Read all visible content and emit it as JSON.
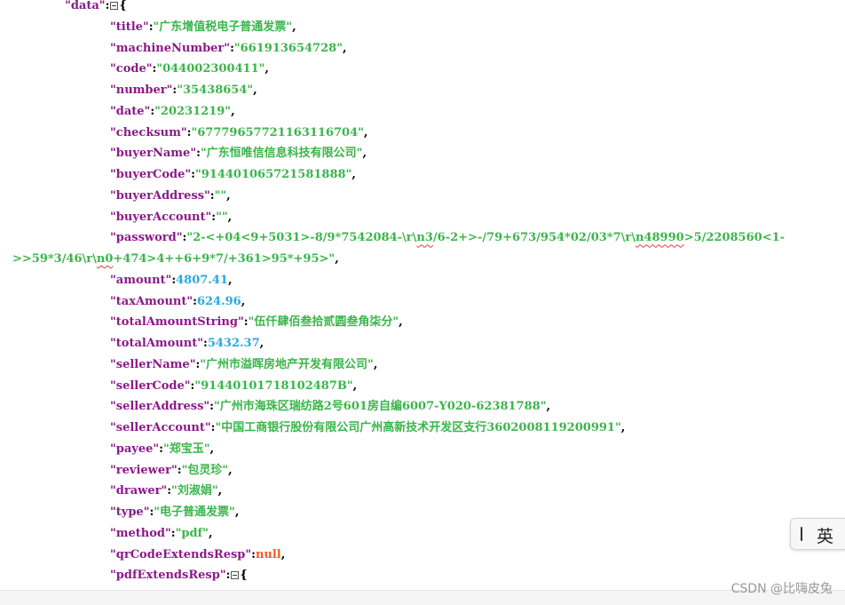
{
  "lines": [
    {
      "indent": "",
      "parts": [
        {
          "t": "  ",
          "c": "p"
        },
        {
          "t": "\"data\"",
          "c": "k"
        },
        {
          "t": ":",
          "c": "p"
        },
        {
          "fold": true
        },
        {
          "t": "{",
          "c": "p"
        }
      ]
    },
    {
      "parts": [
        {
          "t": "\"title\"",
          "c": "k"
        },
        {
          "t": ":",
          "c": "p"
        },
        {
          "t": "\"广东增值税电子普通发票\"",
          "c": "s"
        },
        {
          "t": ",",
          "c": "p"
        }
      ]
    },
    {
      "parts": [
        {
          "t": "\"machineNumber\"",
          "c": "k"
        },
        {
          "t": ":",
          "c": "p"
        },
        {
          "t": "\"661913654728\"",
          "c": "s"
        },
        {
          "t": ",",
          "c": "p"
        }
      ]
    },
    {
      "parts": [
        {
          "t": "\"code\"",
          "c": "k"
        },
        {
          "t": ":",
          "c": "p"
        },
        {
          "t": "\"044002300411\"",
          "c": "s"
        },
        {
          "t": ",",
          "c": "p"
        }
      ]
    },
    {
      "parts": [
        {
          "t": "\"number\"",
          "c": "k"
        },
        {
          "t": ":",
          "c": "p"
        },
        {
          "t": "\"35438654\"",
          "c": "s"
        },
        {
          "t": ",",
          "c": "p"
        }
      ]
    },
    {
      "parts": [
        {
          "t": "\"date\"",
          "c": "k"
        },
        {
          "t": ":",
          "c": "p"
        },
        {
          "t": "\"20231219\"",
          "c": "s"
        },
        {
          "t": ",",
          "c": "p"
        }
      ]
    },
    {
      "parts": [
        {
          "t": "\"checksum\"",
          "c": "k"
        },
        {
          "t": ":",
          "c": "p"
        },
        {
          "t": "\"67779657721163116704\"",
          "c": "s"
        },
        {
          "t": ",",
          "c": "p"
        }
      ]
    },
    {
      "parts": [
        {
          "t": "\"buyerName\"",
          "c": "k"
        },
        {
          "t": ":",
          "c": "p"
        },
        {
          "t": "\"广东恒唯信信息科技有限公司\"",
          "c": "s"
        },
        {
          "t": ",",
          "c": "p"
        }
      ]
    },
    {
      "parts": [
        {
          "t": "\"buyerCode\"",
          "c": "k"
        },
        {
          "t": ":",
          "c": "p"
        },
        {
          "t": "\"914401065721581888\"",
          "c": "s"
        },
        {
          "t": ",",
          "c": "p"
        }
      ]
    },
    {
      "parts": [
        {
          "t": "\"buyerAddress\"",
          "c": "k"
        },
        {
          "t": ":",
          "c": "p"
        },
        {
          "t": "\"\"",
          "c": "s"
        },
        {
          "t": ",",
          "c": "p"
        }
      ]
    },
    {
      "parts": [
        {
          "t": "\"buyerAccount\"",
          "c": "k"
        },
        {
          "t": ":",
          "c": "p"
        },
        {
          "t": "\"\"",
          "c": "s"
        },
        {
          "t": ",",
          "c": "p"
        }
      ]
    },
    {
      "parts": [
        {
          "t": "\"password\"",
          "c": "k"
        },
        {
          "t": ":",
          "c": "p"
        },
        {
          "t": "\"2-<+04<9+5031>-8/9*7542084-\\r\\",
          "c": "s"
        },
        {
          "t": "n3",
          "c": "s",
          "w": true
        },
        {
          "t": "/6-2+>-/79+673/954*02/03*7\\r\\",
          "c": "s"
        },
        {
          "t": "n48990",
          "c": "s",
          "w": true
        },
        {
          "t": ">5/2208560<1-",
          "c": "s"
        }
      ]
    },
    {
      "noindent": true,
      "parts": [
        {
          "t": ">>59*3/46\\r\\",
          "c": "s"
        },
        {
          "t": "n0",
          "c": "s",
          "w": true
        },
        {
          "t": "+474>4++6+9*7/+361>95*+95>\"",
          "c": "s"
        },
        {
          "t": ",",
          "c": "p"
        }
      ]
    },
    {
      "parts": [
        {
          "t": "\"amount\"",
          "c": "k"
        },
        {
          "t": ":",
          "c": "p"
        },
        {
          "t": "4807.41",
          "c": "n"
        },
        {
          "t": ",",
          "c": "p"
        }
      ]
    },
    {
      "parts": [
        {
          "t": "\"taxAmount\"",
          "c": "k"
        },
        {
          "t": ":",
          "c": "p"
        },
        {
          "t": "624.96",
          "c": "n"
        },
        {
          "t": ",",
          "c": "p"
        }
      ]
    },
    {
      "parts": [
        {
          "t": "\"totalAmountString\"",
          "c": "k"
        },
        {
          "t": ":",
          "c": "p"
        },
        {
          "t": "\"伍仟肆佰叁拾贰圆叁角柒分\"",
          "c": "s"
        },
        {
          "t": ",",
          "c": "p"
        }
      ]
    },
    {
      "parts": [
        {
          "t": "\"totalAmount\"",
          "c": "k"
        },
        {
          "t": ":",
          "c": "p"
        },
        {
          "t": "5432.37",
          "c": "n"
        },
        {
          "t": ",",
          "c": "p"
        }
      ]
    },
    {
      "parts": [
        {
          "t": "\"sellerName\"",
          "c": "k"
        },
        {
          "t": ":",
          "c": "p"
        },
        {
          "t": "\"广州市溢晖房地产开发有限公司\"",
          "c": "s"
        },
        {
          "t": ",",
          "c": "p"
        }
      ]
    },
    {
      "parts": [
        {
          "t": "\"sellerCode\"",
          "c": "k"
        },
        {
          "t": ":",
          "c": "p"
        },
        {
          "t": "\"91440101718102487B\"",
          "c": "s"
        },
        {
          "t": ",",
          "c": "p"
        }
      ]
    },
    {
      "parts": [
        {
          "t": "\"sellerAddress\"",
          "c": "k"
        },
        {
          "t": ":",
          "c": "p"
        },
        {
          "t": "\"广州市海珠区瑞纺路2号601房自编6007-Y020-62381788\"",
          "c": "s"
        },
        {
          "t": ",",
          "c": "p"
        }
      ]
    },
    {
      "parts": [
        {
          "t": "\"sellerAccount\"",
          "c": "k"
        },
        {
          "t": ":",
          "c": "p"
        },
        {
          "t": "\"中国工商银行股份有限公司广州高新技术开发区支行3602008119200991\"",
          "c": "s"
        },
        {
          "t": ",",
          "c": "p"
        }
      ]
    },
    {
      "parts": [
        {
          "t": "\"payee\"",
          "c": "k"
        },
        {
          "t": ":",
          "c": "p"
        },
        {
          "t": "\"郑宝玉\"",
          "c": "s"
        },
        {
          "t": ",",
          "c": "p"
        }
      ]
    },
    {
      "parts": [
        {
          "t": "\"reviewer\"",
          "c": "k"
        },
        {
          "t": ":",
          "c": "p"
        },
        {
          "t": "\"包灵珍\"",
          "c": "s"
        },
        {
          "t": ",",
          "c": "p"
        }
      ]
    },
    {
      "parts": [
        {
          "t": "\"drawer\"",
          "c": "k"
        },
        {
          "t": ":",
          "c": "p"
        },
        {
          "t": "\"刘淑娟\"",
          "c": "s"
        },
        {
          "t": ",",
          "c": "p"
        }
      ]
    },
    {
      "parts": [
        {
          "t": "\"type\"",
          "c": "k"
        },
        {
          "t": ":",
          "c": "p"
        },
        {
          "t": "\"电子普通发票\"",
          "c": "s"
        },
        {
          "t": ",",
          "c": "p"
        }
      ]
    },
    {
      "parts": [
        {
          "t": "\"method\"",
          "c": "k"
        },
        {
          "t": ":",
          "c": "p"
        },
        {
          "t": "\"pdf\"",
          "c": "s"
        },
        {
          "t": ",",
          "c": "p"
        }
      ]
    },
    {
      "parts": [
        {
          "t": "\"qrCodeExtendsResp\"",
          "c": "k"
        },
        {
          "t": ":",
          "c": "p"
        },
        {
          "t": "null",
          "c": "nl"
        },
        {
          "t": ",",
          "c": "p"
        }
      ]
    },
    {
      "parts": [
        {
          "t": "\"pdfExtendsResp\"",
          "c": "k"
        },
        {
          "t": ":",
          "c": "p"
        },
        {
          "fold": true
        },
        {
          "t": "{",
          "c": "p"
        }
      ]
    }
  ],
  "ime": {
    "label": "英"
  },
  "watermark": "CSDN @比嗨皮兔",
  "colors": {
    "key": "#8B1A89",
    "string": "#3AB54A",
    "number": "#25AAE2",
    "null": "#F1592A"
  }
}
